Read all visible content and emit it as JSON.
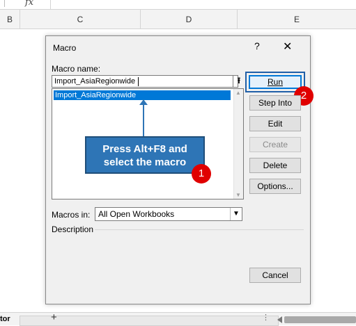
{
  "sheet": {
    "formula_symbol": "fx",
    "columns": [
      "B",
      "C",
      "D",
      "E"
    ],
    "bottom_left_text": "tor",
    "add_sheet": "+",
    "dots": "⋮"
  },
  "dialog": {
    "title": "Macro",
    "help": "?",
    "close": "✕",
    "macro_name_label": "Macro name:",
    "macro_name_value": "Import_AsiaRegionwide",
    "input_button": "⭱",
    "macros": [
      "Import_AsiaRegionwide"
    ],
    "macros_in_label": "Macros in:",
    "macros_in_value": "All Open Workbooks",
    "description_label": "Description",
    "buttons": {
      "run": "Run",
      "step_into": "Step Into",
      "edit": "Edit",
      "create": "Create",
      "delete": "Delete",
      "options": "Options...",
      "cancel": "Cancel"
    }
  },
  "annotation": {
    "text_line1": "Press Alt+F8 and",
    "text_line2": "select the macro",
    "badge1": "1",
    "badge2": "2",
    "color": "#2e75b6",
    "badge_color": "#e00000"
  }
}
